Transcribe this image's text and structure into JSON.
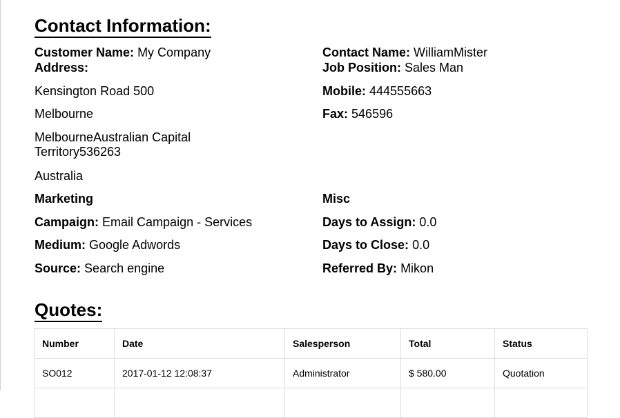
{
  "contact": {
    "title": "Contact Information:",
    "customer_label": "Customer Name:",
    "customer_value": "My Company",
    "address_label": "Address:",
    "address_lines": [
      "Kensington Road 500",
      "Melbourne",
      "MelbourneAustralian Capital Territory536263",
      "Australia"
    ],
    "contact_label": "Contact Name:",
    "contact_value": "WilliamMister",
    "job_label": "Job Position:",
    "job_value": "Sales Man",
    "mobile_label": "Mobile:",
    "mobile_value": "444555663",
    "fax_label": "Fax:",
    "fax_value": "546596"
  },
  "marketing": {
    "heading": "Marketing",
    "campaign_label": "Campaign:",
    "campaign_value": "Email Campaign - Services",
    "medium_label": "Medium:",
    "medium_value": "Google Adwords",
    "source_label": "Source:",
    "source_value": "Search engine"
  },
  "misc": {
    "heading": "Misc",
    "assign_label": "Days to Assign:",
    "assign_value": "0.0",
    "close_label": "Days to Close:",
    "close_value": "0.0",
    "referred_label": "Referred By:",
    "referred_value": "Mikon"
  },
  "quotes": {
    "title": "Quotes:",
    "columns": [
      "Number",
      "Date",
      "Salesperson",
      "Total",
      "Status"
    ],
    "rows": [
      [
        "SO012",
        "2017-01-12 12:08:37",
        "Administrator",
        "$ 580.00",
        "Quotation"
      ],
      [
        "",
        "",
        "",
        "",
        ""
      ]
    ]
  }
}
